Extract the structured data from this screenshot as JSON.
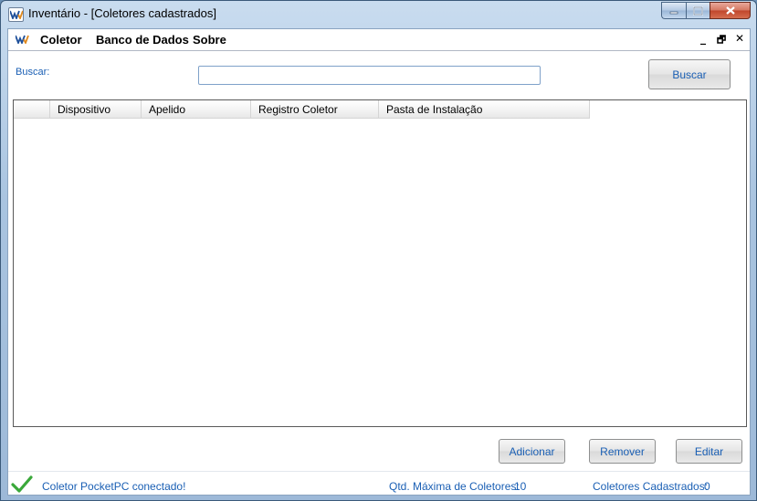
{
  "window": {
    "title": "Inventário - [Coletores cadastrados]"
  },
  "menu": {
    "items": [
      "Coletor",
      "Banco de Dados",
      "Sobre"
    ]
  },
  "mdi_controls": {
    "minimize": "_",
    "restore": "🗗",
    "close": "✕"
  },
  "search": {
    "label": "Buscar:",
    "value": "",
    "button_label": "Buscar"
  },
  "table": {
    "columns": [
      "",
      "Dispositivo",
      "Apelido",
      "Registro Coletor",
      "Pasta de Instalação"
    ],
    "rows": []
  },
  "actions": {
    "add_label": "Adicionar",
    "remove_label": "Remover",
    "edit_label": "Editar"
  },
  "status": {
    "message": "Coletor PocketPC conectado!",
    "max_label": "Qtd. Máxima de Coletores:",
    "max_value": "10",
    "registered_label": "Coletores Cadastrados:",
    "registered_value": "0"
  },
  "colors": {
    "accent_text": "#1a5fb4",
    "status_ok": "#3aa83a"
  }
}
